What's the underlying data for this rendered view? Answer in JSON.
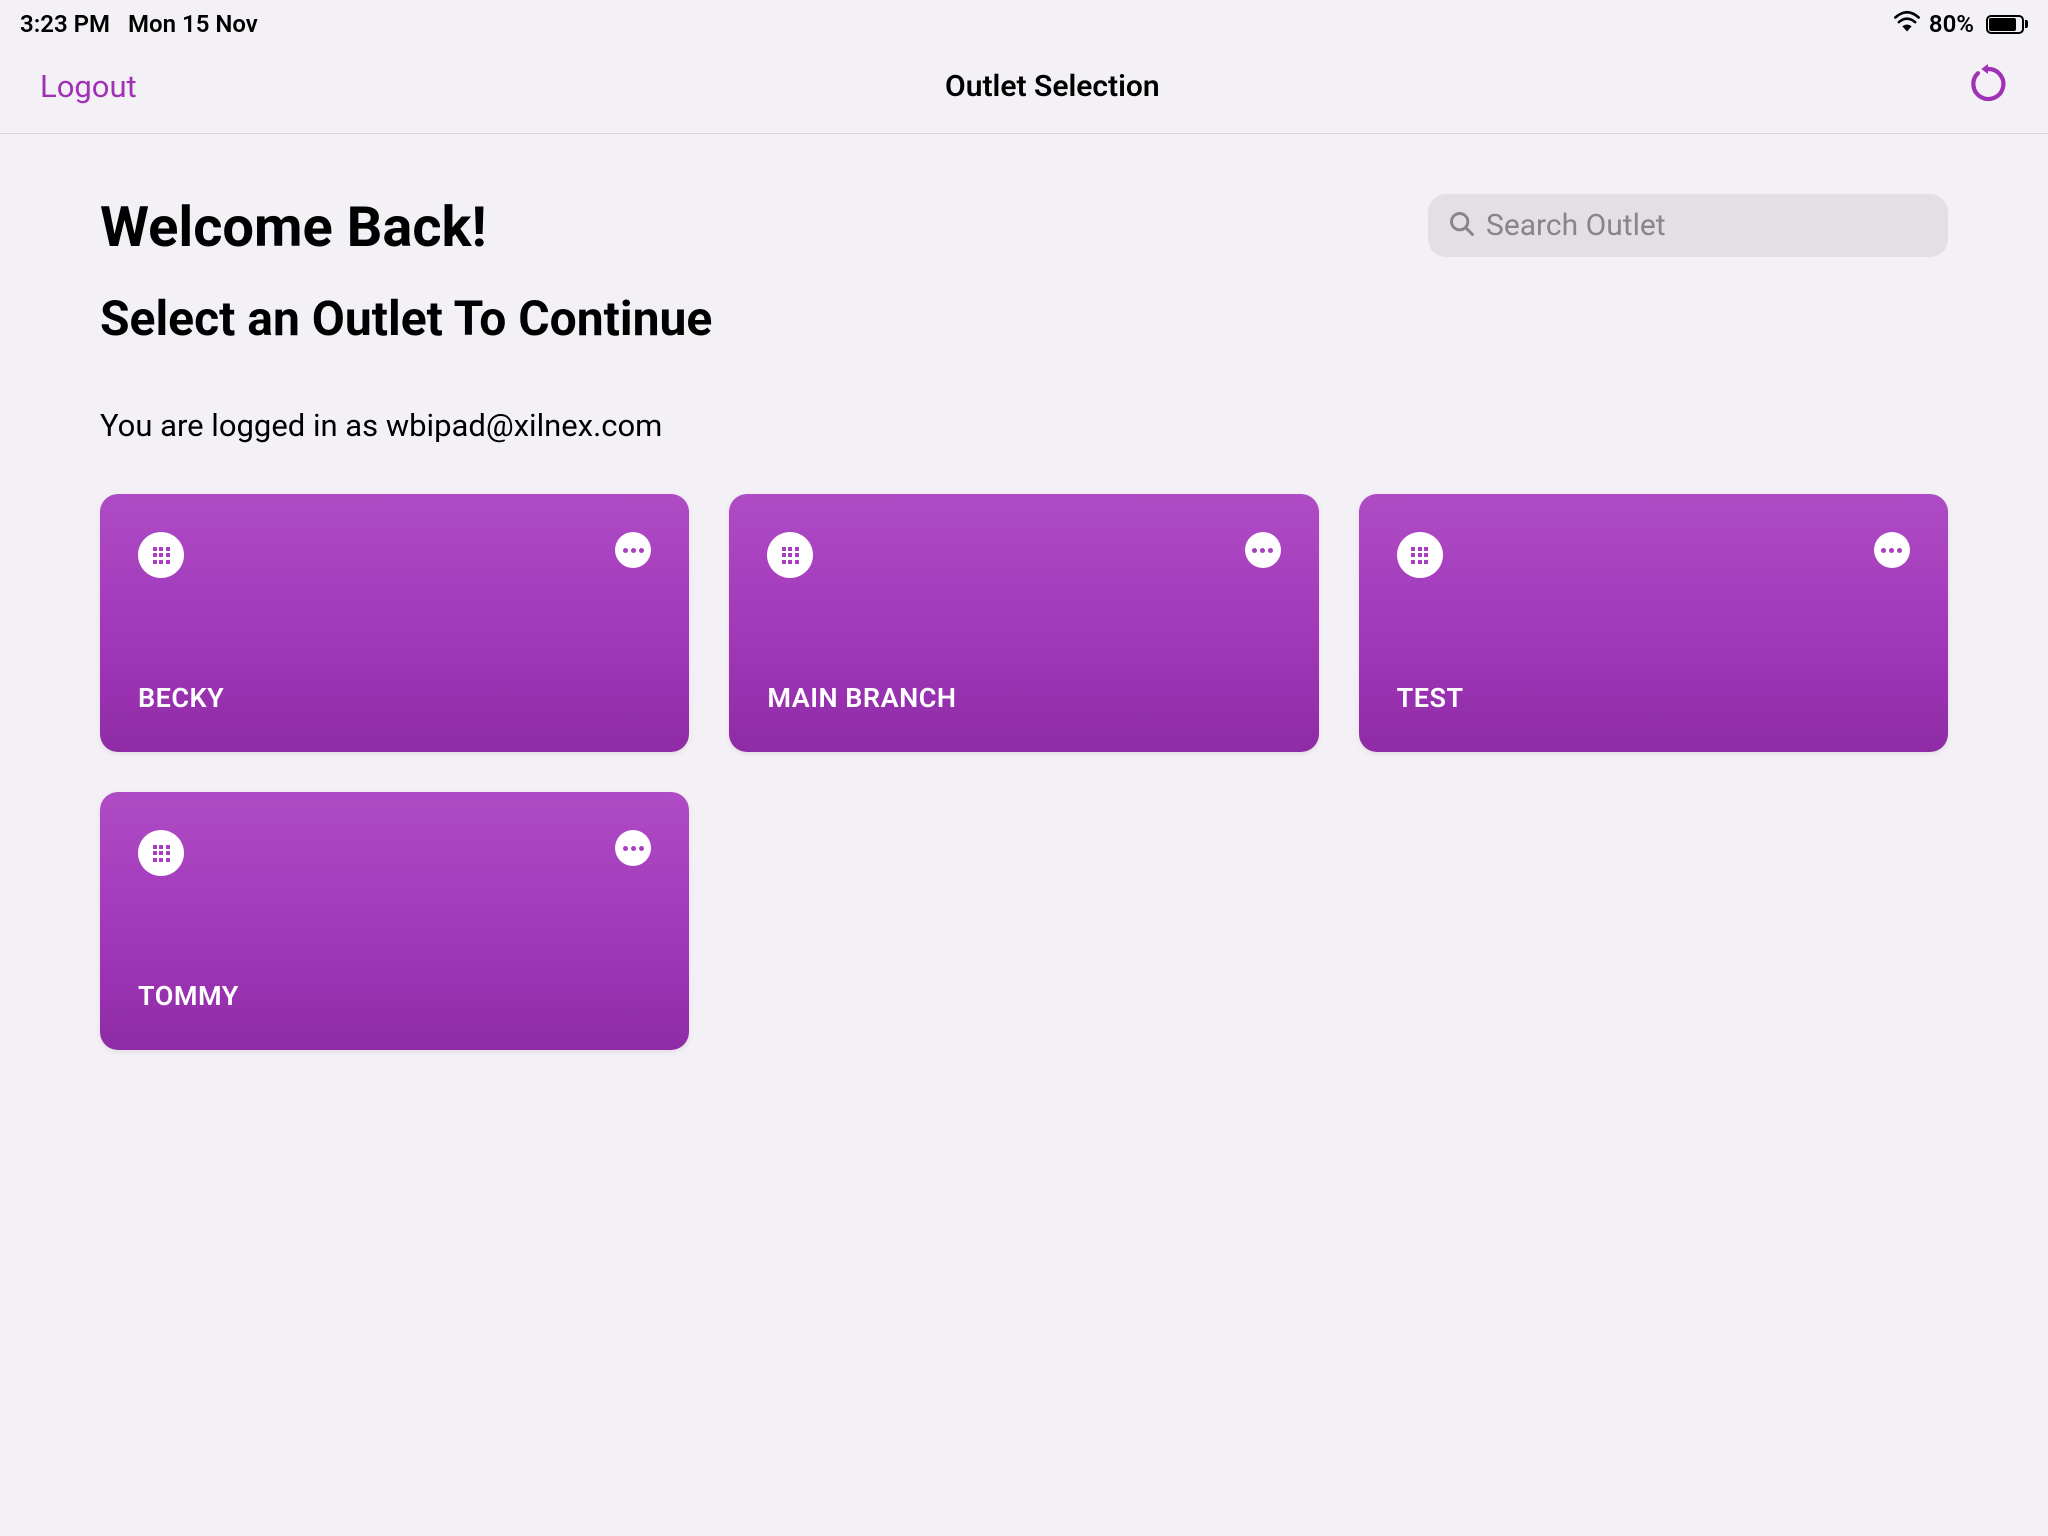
{
  "statusBar": {
    "time": "3:23 PM",
    "date": "Mon 15 Nov",
    "batteryPercent": "80%"
  },
  "navBar": {
    "logout": "Logout",
    "title": "Outlet Selection"
  },
  "content": {
    "welcome": "Welcome Back!",
    "subtitle": "Select an Outlet To Continue",
    "loggedInAs": "You are logged in as wbipad@xilnex.com"
  },
  "search": {
    "placeholder": "Search Outlet"
  },
  "outlets": [
    {
      "name": "BECKY"
    },
    {
      "name": "MAIN BRANCH"
    },
    {
      "name": "TEST"
    },
    {
      "name": "TOMMY"
    }
  ]
}
